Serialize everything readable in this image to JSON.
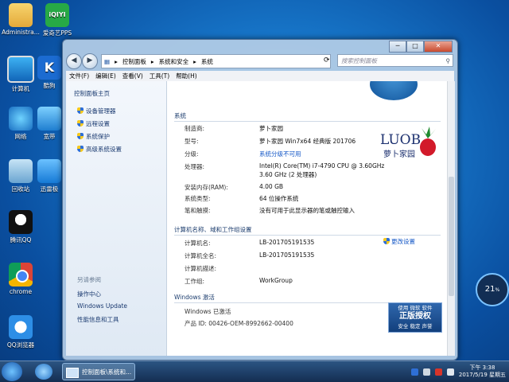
{
  "desktop": {
    "icons": [
      {
        "label": "Administra..."
      },
      {
        "label": "爱奇艺PPS",
        "logo": "iQIYI"
      },
      {
        "label": "计算机"
      },
      {
        "label": "酷狗"
      },
      {
        "label": "网络"
      },
      {
        "label": "宽带"
      },
      {
        "label": "回收站"
      },
      {
        "label": "迅雷极"
      },
      {
        "label": "腾讯QQ"
      },
      {
        "label": "chrome"
      },
      {
        "label": "QQ浏览器"
      }
    ]
  },
  "window": {
    "controls": {
      "minimize": "─",
      "maximize": "□",
      "close": "✕"
    },
    "address": {
      "segments": [
        "控制面板",
        "系统和安全",
        "系统"
      ],
      "separator": "▸"
    },
    "search_placeholder": "搜索控制面板",
    "menu": [
      "文件(F)",
      "编辑(E)",
      "查看(V)",
      "工具(T)",
      "帮助(H)"
    ],
    "sidebar": {
      "home": "控制面板主页",
      "links": [
        "设备管理器",
        "远程设置",
        "系统保护",
        "高级系统设置"
      ],
      "see_also_title": "另请参阅",
      "see_also": [
        "操作中心",
        "Windows Update",
        "性能信息和工具"
      ]
    },
    "system": {
      "section": "系统",
      "rows": [
        {
          "label": "制造商:",
          "value": "萝卜家园"
        },
        {
          "label": "型号:",
          "value": "萝卜家园 Win7x64 经典版 201706"
        },
        {
          "label": "分级:",
          "value": "系统分级不可用"
        },
        {
          "label": "处理器:",
          "value": "Intel(R) Core(TM) i7-4790 CPU @ 3.60GHz",
          "value2": "3.60 GHz  (2 处理器)"
        },
        {
          "label": "安装内存(RAM):",
          "value": "4.00 GB"
        },
        {
          "label": "系统类型:",
          "value": "64 位操作系统"
        },
        {
          "label": "笔和触摸:",
          "value": "没有可用于此显示器的笔或触控输入"
        }
      ],
      "logo_text": "LUOB",
      "logo_sub": "萝卜家园"
    },
    "computer": {
      "section": "计算机名称、域和工作组设置",
      "change_link": "更改设置",
      "rows": [
        {
          "label": "计算机名:",
          "value": "LB-201705191535"
        },
        {
          "label": "计算机全名:",
          "value": "LB-201705191535"
        },
        {
          "label": "计算机描述:",
          "value": ""
        },
        {
          "label": "工作组:",
          "value": "WorkGroup"
        }
      ]
    },
    "activation": {
      "section": "Windows 激活",
      "status": "Windows 已激活",
      "product_id": "产品 ID: 00426-OEM-8992662-00400",
      "badge_top": "使用 微软 软件",
      "badge_main": "正版授权",
      "badge_bottom": "安全 稳定 声誉"
    }
  },
  "taskbar": {
    "window_label": "控制面板\\系统和...",
    "time": "下午 3:38",
    "date": "2017/5/19 星期五"
  },
  "gauge": "21",
  "gauge_unit": "%"
}
